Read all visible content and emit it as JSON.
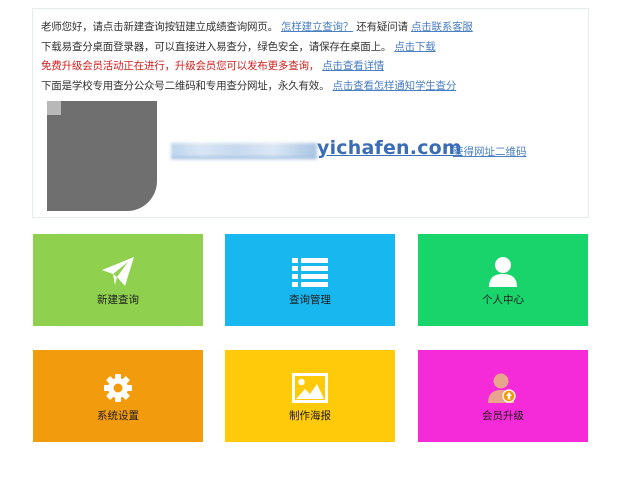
{
  "notice": {
    "line1": {
      "text": "老师您好，请点击新建查询按钮建立成绩查询网页。",
      "link1": "怎样建立查询？",
      "mid": "还有疑问请",
      "link2": "点击联系客服"
    },
    "line2": {
      "text": "下载易查分桌面登录器，可以直接进入易查分，绿色安全，请保存在桌面上。",
      "link": "点击下载"
    },
    "line3": {
      "text": "免费升级会员活动正在进行，升级会员您可以发布更多查询，",
      "link": "点击查看详情"
    },
    "line4": {
      "text": "下面是学校专用查分公众号二维码和专用查分网址，永久有效。",
      "link": "点击查看怎样通知学生查分"
    },
    "url_visible": "yichafen.com",
    "url_qr_link": "获得网址二维码"
  },
  "tiles": [
    {
      "label": "新建查询",
      "icon": "paper-plane-icon",
      "color": "#8fd14f"
    },
    {
      "label": "查询管理",
      "icon": "list-icon",
      "color": "#19b7f0"
    },
    {
      "label": "个人中心",
      "icon": "user-icon",
      "color": "#19d36b"
    },
    {
      "label": "系统设置",
      "icon": "gear-icon",
      "color": "#f29b0c"
    },
    {
      "label": "制作海报",
      "icon": "image-icon",
      "color": "#ffca0a"
    },
    {
      "label": "会员升级",
      "icon": "member-upgrade-icon",
      "color": "#f52ad8"
    }
  ]
}
